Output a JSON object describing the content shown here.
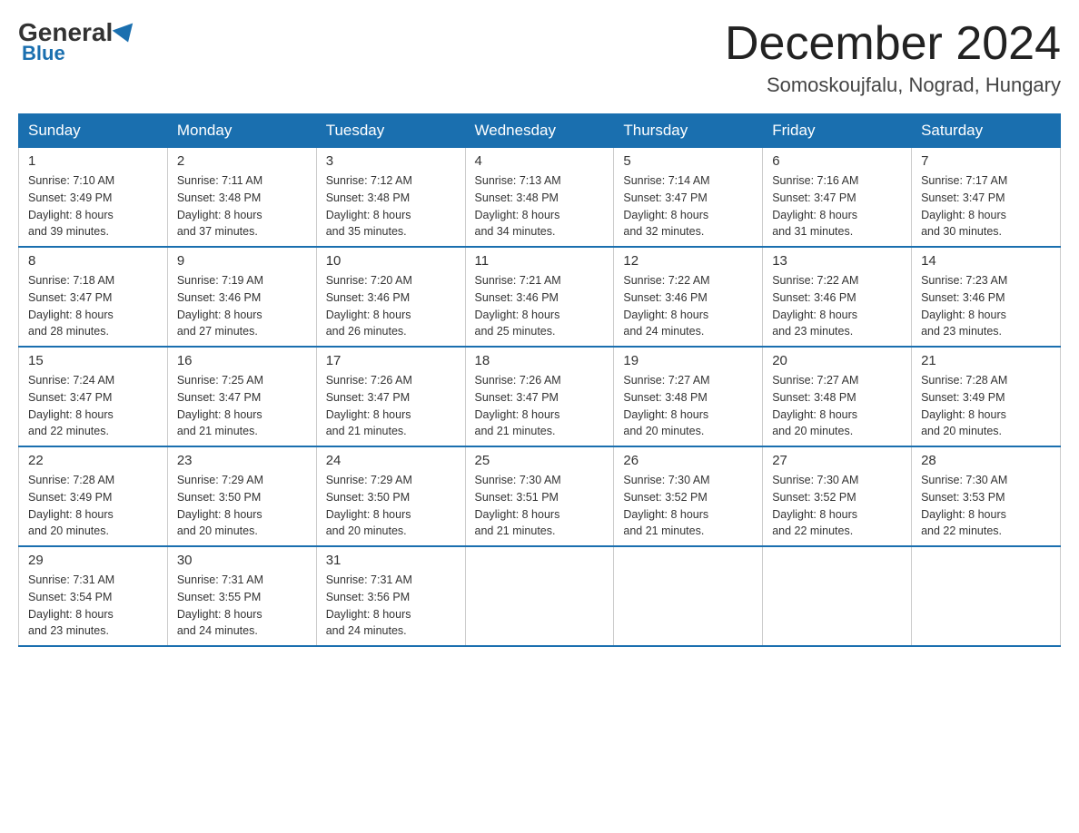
{
  "logo": {
    "general": "General",
    "blue": "Blue"
  },
  "title": "December 2024",
  "subtitle": "Somoskoujfalu, Nograd, Hungary",
  "days_of_week": [
    "Sunday",
    "Monday",
    "Tuesday",
    "Wednesday",
    "Thursday",
    "Friday",
    "Saturday"
  ],
  "weeks": [
    [
      {
        "day": "1",
        "sunrise": "7:10 AM",
        "sunset": "3:49 PM",
        "daylight": "8 hours and 39 minutes."
      },
      {
        "day": "2",
        "sunrise": "7:11 AM",
        "sunset": "3:48 PM",
        "daylight": "8 hours and 37 minutes."
      },
      {
        "day": "3",
        "sunrise": "7:12 AM",
        "sunset": "3:48 PM",
        "daylight": "8 hours and 35 minutes."
      },
      {
        "day": "4",
        "sunrise": "7:13 AM",
        "sunset": "3:48 PM",
        "daylight": "8 hours and 34 minutes."
      },
      {
        "day": "5",
        "sunrise": "7:14 AM",
        "sunset": "3:47 PM",
        "daylight": "8 hours and 32 minutes."
      },
      {
        "day": "6",
        "sunrise": "7:16 AM",
        "sunset": "3:47 PM",
        "daylight": "8 hours and 31 minutes."
      },
      {
        "day": "7",
        "sunrise": "7:17 AM",
        "sunset": "3:47 PM",
        "daylight": "8 hours and 30 minutes."
      }
    ],
    [
      {
        "day": "8",
        "sunrise": "7:18 AM",
        "sunset": "3:47 PM",
        "daylight": "8 hours and 28 minutes."
      },
      {
        "day": "9",
        "sunrise": "7:19 AM",
        "sunset": "3:46 PM",
        "daylight": "8 hours and 27 minutes."
      },
      {
        "day": "10",
        "sunrise": "7:20 AM",
        "sunset": "3:46 PM",
        "daylight": "8 hours and 26 minutes."
      },
      {
        "day": "11",
        "sunrise": "7:21 AM",
        "sunset": "3:46 PM",
        "daylight": "8 hours and 25 minutes."
      },
      {
        "day": "12",
        "sunrise": "7:22 AM",
        "sunset": "3:46 PM",
        "daylight": "8 hours and 24 minutes."
      },
      {
        "day": "13",
        "sunrise": "7:22 AM",
        "sunset": "3:46 PM",
        "daylight": "8 hours and 23 minutes."
      },
      {
        "day": "14",
        "sunrise": "7:23 AM",
        "sunset": "3:46 PM",
        "daylight": "8 hours and 23 minutes."
      }
    ],
    [
      {
        "day": "15",
        "sunrise": "7:24 AM",
        "sunset": "3:47 PM",
        "daylight": "8 hours and 22 minutes."
      },
      {
        "day": "16",
        "sunrise": "7:25 AM",
        "sunset": "3:47 PM",
        "daylight": "8 hours and 21 minutes."
      },
      {
        "day": "17",
        "sunrise": "7:26 AM",
        "sunset": "3:47 PM",
        "daylight": "8 hours and 21 minutes."
      },
      {
        "day": "18",
        "sunrise": "7:26 AM",
        "sunset": "3:47 PM",
        "daylight": "8 hours and 21 minutes."
      },
      {
        "day": "19",
        "sunrise": "7:27 AM",
        "sunset": "3:48 PM",
        "daylight": "8 hours and 20 minutes."
      },
      {
        "day": "20",
        "sunrise": "7:27 AM",
        "sunset": "3:48 PM",
        "daylight": "8 hours and 20 minutes."
      },
      {
        "day": "21",
        "sunrise": "7:28 AM",
        "sunset": "3:49 PM",
        "daylight": "8 hours and 20 minutes."
      }
    ],
    [
      {
        "day": "22",
        "sunrise": "7:28 AM",
        "sunset": "3:49 PM",
        "daylight": "8 hours and 20 minutes."
      },
      {
        "day": "23",
        "sunrise": "7:29 AM",
        "sunset": "3:50 PM",
        "daylight": "8 hours and 20 minutes."
      },
      {
        "day": "24",
        "sunrise": "7:29 AM",
        "sunset": "3:50 PM",
        "daylight": "8 hours and 20 minutes."
      },
      {
        "day": "25",
        "sunrise": "7:30 AM",
        "sunset": "3:51 PM",
        "daylight": "8 hours and 21 minutes."
      },
      {
        "day": "26",
        "sunrise": "7:30 AM",
        "sunset": "3:52 PM",
        "daylight": "8 hours and 21 minutes."
      },
      {
        "day": "27",
        "sunrise": "7:30 AM",
        "sunset": "3:52 PM",
        "daylight": "8 hours and 22 minutes."
      },
      {
        "day": "28",
        "sunrise": "7:30 AM",
        "sunset": "3:53 PM",
        "daylight": "8 hours and 22 minutes."
      }
    ],
    [
      {
        "day": "29",
        "sunrise": "7:31 AM",
        "sunset": "3:54 PM",
        "daylight": "8 hours and 23 minutes."
      },
      {
        "day": "30",
        "sunrise": "7:31 AM",
        "sunset": "3:55 PM",
        "daylight": "8 hours and 24 minutes."
      },
      {
        "day": "31",
        "sunrise": "7:31 AM",
        "sunset": "3:56 PM",
        "daylight": "8 hours and 24 minutes."
      },
      null,
      null,
      null,
      null
    ]
  ]
}
